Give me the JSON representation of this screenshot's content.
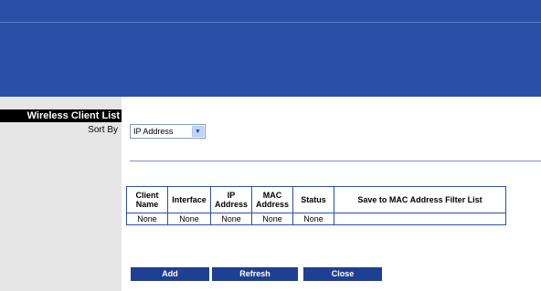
{
  "sidebar": {
    "title": "Wireless Client List",
    "sort_label": "Sort By"
  },
  "sort": {
    "selected": "IP Address",
    "arrow_icon": "chevron-down-icon"
  },
  "table": {
    "headers": [
      "Client Name",
      "Interface",
      "IP Address",
      "MAC Address",
      "Status",
      "Save to MAC Address Filter List"
    ],
    "rows": [
      [
        "None",
        "None",
        "None",
        "None",
        "None",
        ""
      ]
    ]
  },
  "buttons": {
    "add": "Add",
    "refresh": "Refresh",
    "close": "Close"
  },
  "colors": {
    "header_band": "#2a4fa9",
    "button": "#1f3f93",
    "table_border": "#2a4fa9"
  }
}
